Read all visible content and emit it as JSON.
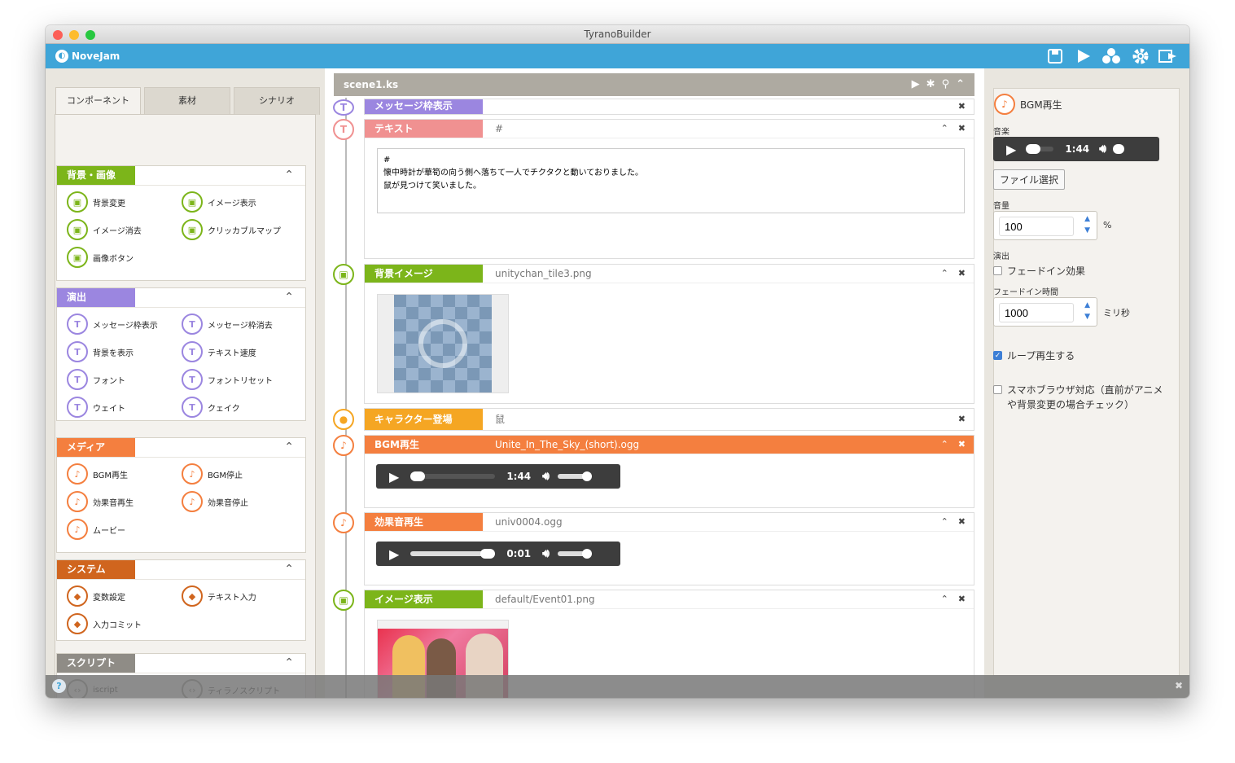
{
  "window": {
    "title": "TyranoBuilder"
  },
  "appbar": {
    "name": "NoveJam",
    "icons": [
      "save-icon",
      "play-icon",
      "character-icon",
      "gear-icon",
      "export-icon"
    ]
  },
  "left": {
    "tabs": [
      "コンポーネント",
      "素材",
      "シナリオ"
    ],
    "groups": [
      {
        "label": "背景・画像",
        "color": "#7cb51a",
        "items": [
          "背景変更",
          "イメージ表示",
          "イメージ消去",
          "クリッカブルマップ",
          "画像ボタン"
        ]
      },
      {
        "label": "演出",
        "color": "#9b86e0",
        "items": [
          "メッセージ枠表示",
          "メッセージ枠消去",
          "背景を表示",
          "テキスト速度",
          "フォント",
          "フォントリセット",
          "ウェイト",
          "クェイク"
        ]
      },
      {
        "label": "メディア",
        "color": "#f47f3f",
        "items": [
          "BGM再生",
          "BGM停止",
          "効果音再生",
          "効果音停止",
          "ムービー"
        ]
      },
      {
        "label": "システム",
        "color": "#d0651e",
        "items": [
          "変数設定",
          "テキスト入力",
          "入力コミット"
        ]
      },
      {
        "label": "スクリプト",
        "color": "#8f8c86",
        "items": [
          "iscript",
          "ティラノスクリプト"
        ]
      }
    ]
  },
  "center": {
    "file": "scene1.ks",
    "blocks": [
      {
        "tag": "メッセージ枠表示",
        "value": "",
        "color": "#9b86e0"
      },
      {
        "tag": "テキスト",
        "value": "#",
        "color": "#f09191",
        "text": "#\n懐中時計が華筍の向う側へ落ちて一人でチクタクと動いておりました。\n鼠が見つけて笑いました。"
      },
      {
        "tag": "背景イメージ",
        "value": "unitychan_tile3.png",
        "color": "#7cb51a"
      },
      {
        "tag": "キャラクター登場",
        "value": "鼠",
        "color": "#f5a623"
      },
      {
        "tag": "BGM再生",
        "value": "Unite_In_The_Sky_(short).ogg",
        "color": "#f47f3f",
        "time": "1:44"
      },
      {
        "tag": "効果音再生",
        "value": "univ0004.ogg",
        "color": "#f47f3f",
        "time": "0:01"
      },
      {
        "tag": "イメージ表示",
        "value": "default/Event01.png",
        "color": "#7cb51a"
      }
    ]
  },
  "right": {
    "title": "BGM再生",
    "music_label": "音楽",
    "player_time": "1:44",
    "file_button": "ファイル選択",
    "volume_label": "音量",
    "volume": "100",
    "volume_unit": "%",
    "effect_label": "演出",
    "fadein_label": "フェードイン効果",
    "fadein_time_label": "フェードイン時間",
    "fadein_time": "1000",
    "fadein_unit": "ミリ秒",
    "loop_label": "ループ再生する",
    "smartphone_label": "スマホブラウザ対応（直前がアニメや背景変更の場合チェック）"
  }
}
